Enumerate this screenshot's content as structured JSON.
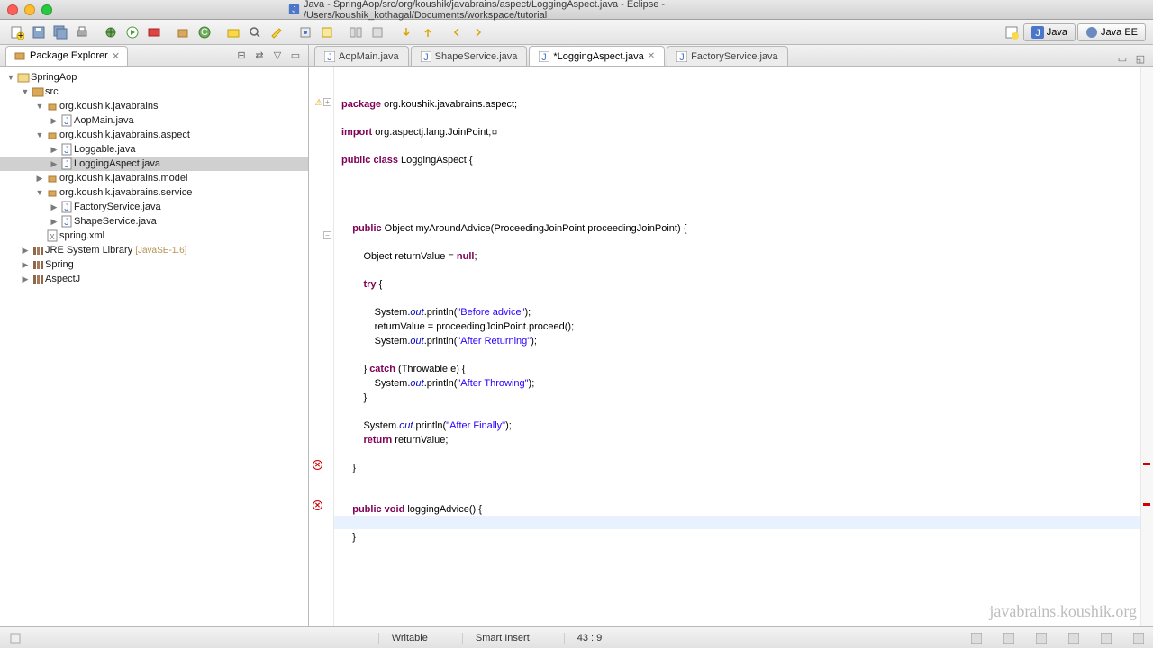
{
  "window": {
    "title": "Java - SpringAop/src/org/koushik/javabrains/aspect/LoggingAspect.java - Eclipse - /Users/koushik_kothagal/Documents/workspace/tutorial"
  },
  "perspectives": {
    "java": "Java",
    "javaee": "Java EE"
  },
  "package_explorer": {
    "title": "Package Explorer",
    "tree": {
      "project": "SpringAop",
      "src": "src",
      "pkg1": "org.koushik.javabrains",
      "pkg1_files": [
        "AopMain.java"
      ],
      "pkg2": "org.koushik.javabrains.aspect",
      "pkg2_files": [
        "Loggable.java",
        "LoggingAspect.java"
      ],
      "pkg3": "org.koushik.javabrains.model",
      "pkg4": "org.koushik.javabrains.service",
      "pkg4_files": [
        "FactoryService.java",
        "ShapeService.java"
      ],
      "spring_xml": "spring.xml",
      "jre": "JRE System Library",
      "jre_suffix": "[JavaSE-1.6]",
      "spring_lib": "Spring",
      "aspectj_lib": "AspectJ"
    }
  },
  "editor": {
    "tabs": [
      {
        "label": "AopMain.java",
        "dirty": false,
        "active": false
      },
      {
        "label": "ShapeService.java",
        "dirty": false,
        "active": false
      },
      {
        "label": "*LoggingAspect.java",
        "dirty": true,
        "active": true
      },
      {
        "label": "FactoryService.java",
        "dirty": false,
        "active": false
      }
    ],
    "code": {
      "l1a": "package",
      "l1b": " org.koushik.javabrains.aspect;",
      "l3a": "import",
      "l3b": " org.aspectj.lang.JoinPoint;",
      "l6a": "public",
      "l6b": " class",
      "l6c": " LoggingAspect {",
      "l13a": "    public",
      "l13b": " Object myAroundAdvice(ProceedingJoinPoint proceedingJoinPoint) {",
      "l15a": "        Object returnValue = ",
      "l15b": "null",
      "l15c": ";",
      "l17a": "        try",
      "l17b": " {",
      "l19a": "            System.",
      "l19b": "out",
      "l19c": ".println(",
      "l19d": "\"Before advice\"",
      "l19e": ");",
      "l20a": "            returnValue = proceedingJoinPoint.proceed();",
      "l21a": "            System.",
      "l21b": "out",
      "l21c": ".println(",
      "l21d": "\"After Returning\"",
      "l21e": ");",
      "l23a": "        } ",
      "l23b": "catch",
      "l23c": " (Throwable e) {",
      "l24a": "            System.",
      "l24b": "out",
      "l24c": ".println(",
      "l24d": "\"After Throwing\"",
      "l24e": ");",
      "l25a": "        }",
      "l27a": "        System.",
      "l27b": "out",
      "l27c": ".println(",
      "l27d": "\"After Finally\"",
      "l27e": ");",
      "l28a": "        return",
      "l28b": " returnValue;",
      "l30a": "    }",
      "l33a": "    public",
      "l33b": " void",
      "l33c": " loggingAdvice() {",
      "l35a": "    }"
    }
  },
  "status": {
    "writable": "Writable",
    "insert": "Smart Insert",
    "pos": "43 : 9"
  },
  "watermark": "javabrains.koushik.org"
}
